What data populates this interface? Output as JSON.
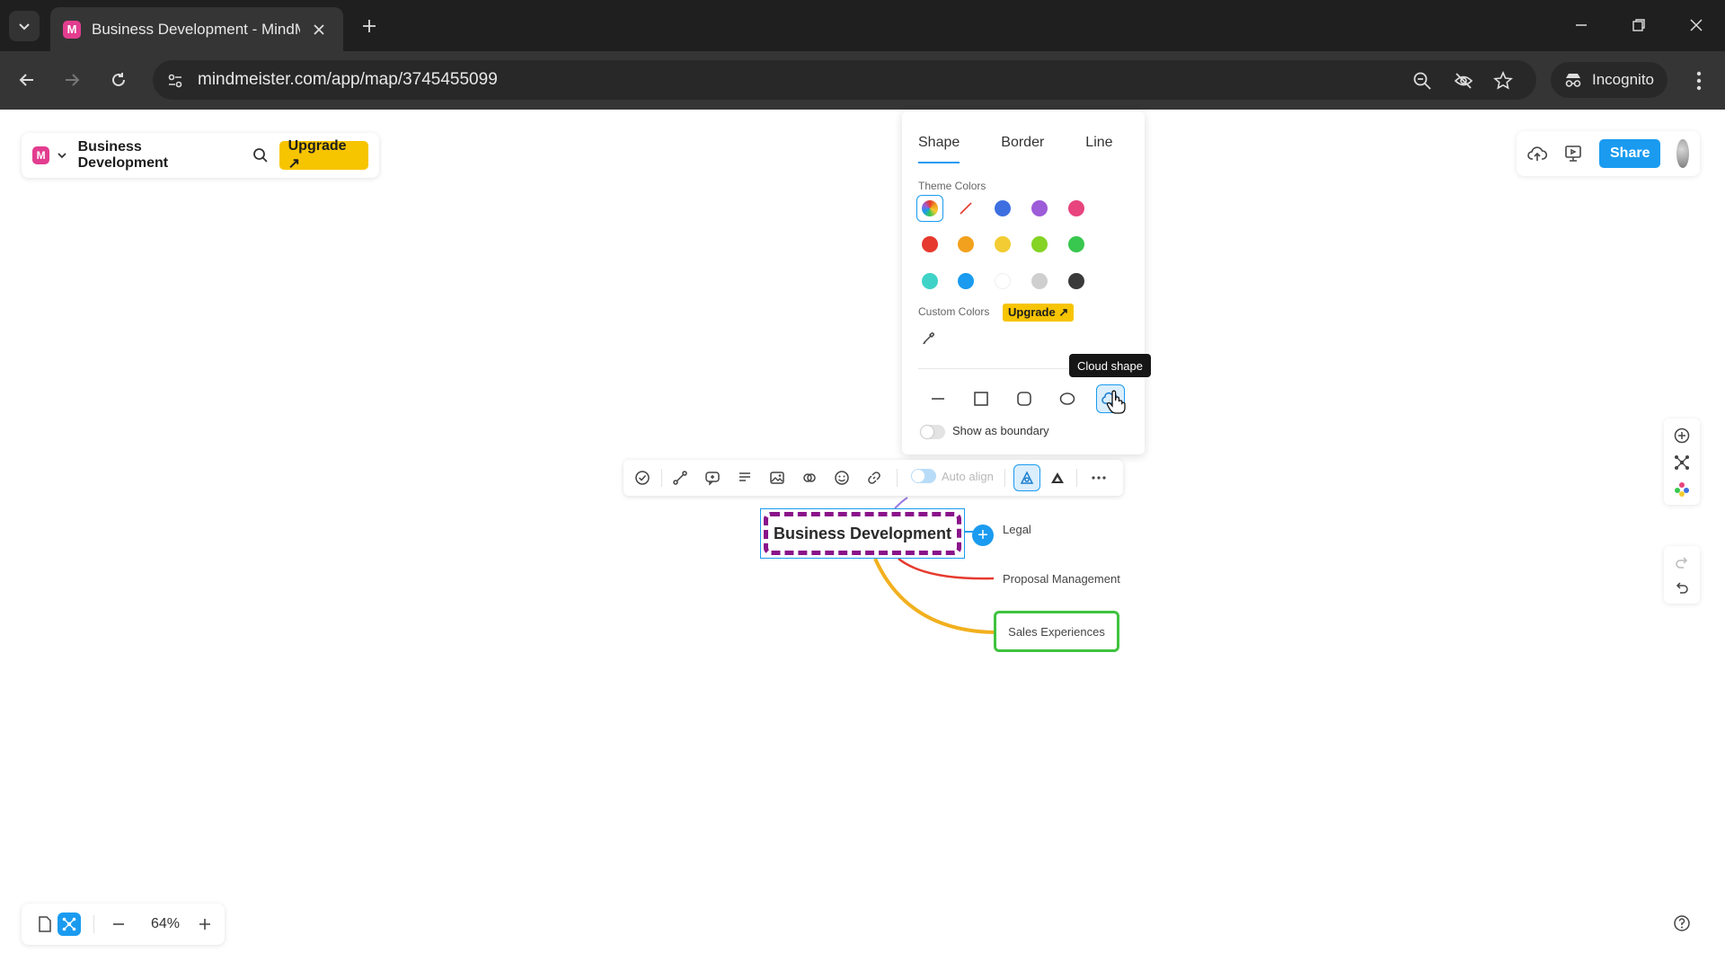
{
  "browser": {
    "tab_title": "Business Development - MindMeister",
    "url": "mindmeister.com/app/map/3745455099",
    "incognito_label": "Incognito",
    "favicon_letter": "M"
  },
  "app": {
    "logo_letter": "M",
    "map_title": "Business Development",
    "upgrade_label": "Upgrade ↗",
    "share_label": "Share",
    "zoom": "64%"
  },
  "style_panel": {
    "tabs": [
      "Shape",
      "Border",
      "Line"
    ],
    "active_tab": "Shape",
    "theme_colors_label": "Theme Colors",
    "custom_colors_label": "Custom Colors",
    "custom_upgrade_label": "Upgrade ↗",
    "show_boundary_label": "Show as boundary",
    "theme_colors": [
      [
        "rainbow",
        "none",
        "#3d6fe0",
        "#9d5cd8",
        "#e8447e"
      ],
      [
        "#e63a2e",
        "#f2a11e",
        "#f2cc32",
        "#84d325",
        "#38c74f"
      ],
      [
        "#3ed3c6",
        "#1a9bf0",
        "#ffffff",
        "#cfcfcf",
        "#3a3a3a"
      ]
    ],
    "shapes": [
      "line-shape-icon",
      "square-shape-icon",
      "rounded-shape-icon",
      "ellipse-shape-icon",
      "cloud-shape-icon"
    ],
    "active_shape": "cloud-shape-icon"
  },
  "tooltip": "Cloud shape",
  "toolbar": {
    "auto_align_label": "Auto align"
  },
  "mindmap": {
    "root": "Business Development",
    "children": [
      "Legal",
      "Proposal Management",
      "Sales Experiences"
    ],
    "colors": {
      "root_border": "#8a138a",
      "selection": "#1a9bf0",
      "branch_red": "#e63a2e",
      "branch_yellow": "#f2b01e",
      "sales_border": "#3fc33f"
    }
  }
}
